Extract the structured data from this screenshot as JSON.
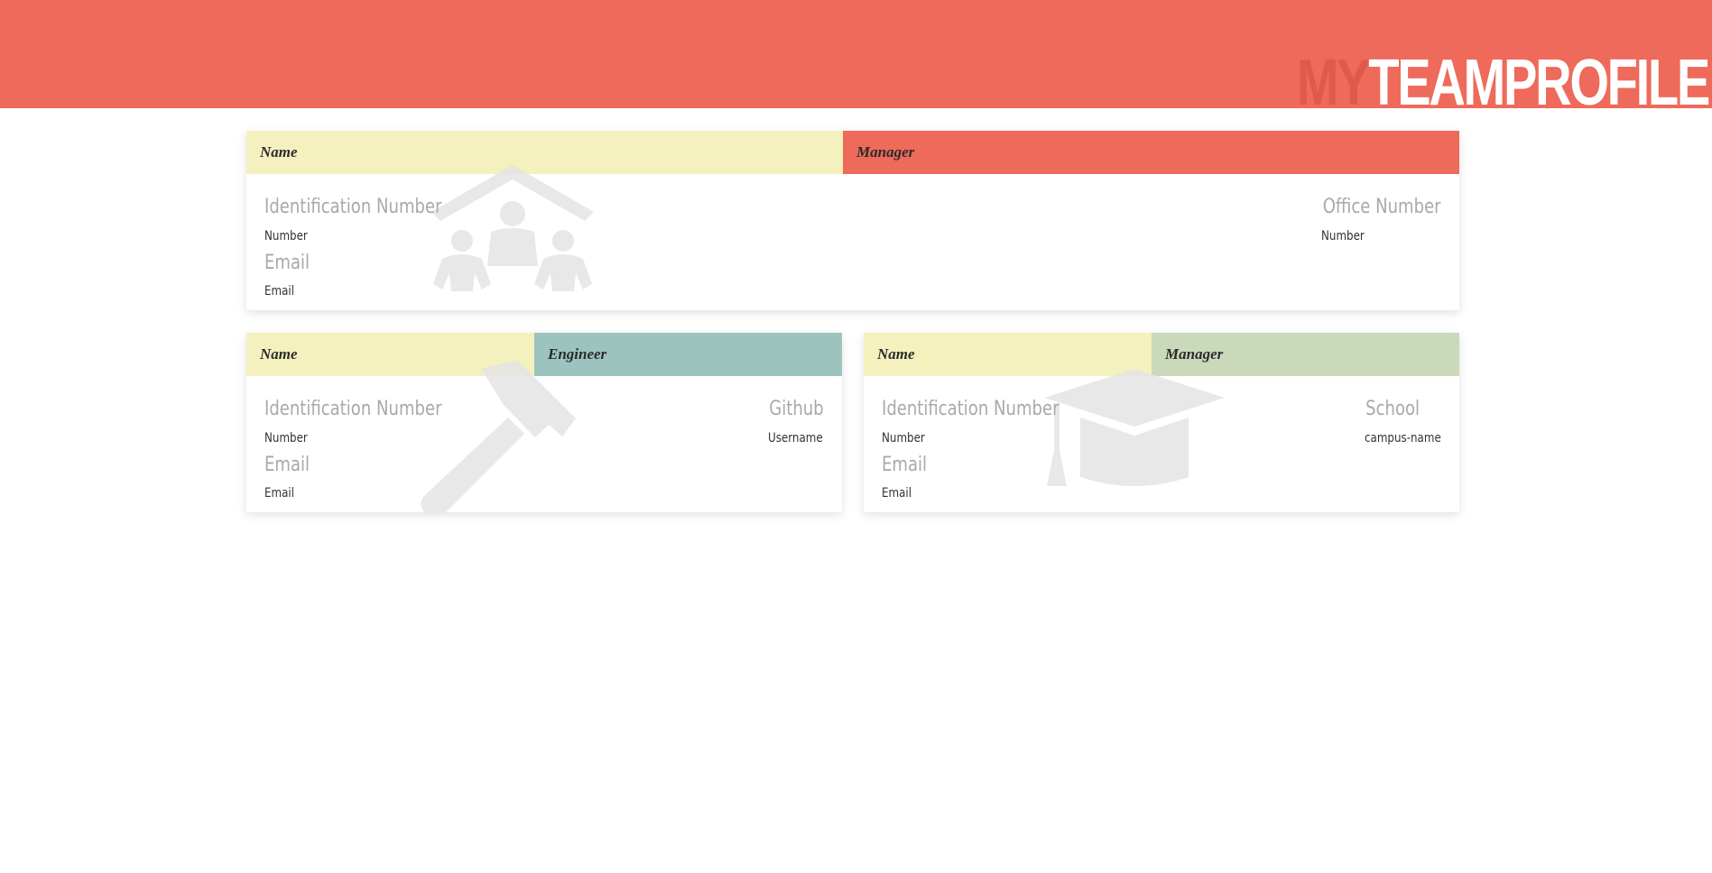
{
  "header": {
    "brand_prefix": "MY",
    "brand_main": "TEAMPROFILE",
    "background": "#ee6a5a"
  },
  "cards": [
    {
      "name": "Name",
      "role": "Manager",
      "role_color": "#ee6a5a",
      "icon": "family-icon",
      "id_label": "Identification Number",
      "id_value": "Number",
      "email_label": "Email",
      "email_value": "Email",
      "extra_label": "Office Number",
      "extra_value": "Number"
    },
    {
      "name": "Name",
      "role": "Engineer",
      "role_color": "#9cc3bd",
      "icon": "hammer-icon",
      "id_label": "Identification Number",
      "id_value": "Number",
      "email_label": "Email",
      "email_value": "Email",
      "extra_label": "Github",
      "extra_value": "Username"
    },
    {
      "name": "Name",
      "role": "Manager",
      "role_color": "#c9d9b9",
      "icon": "graduation-cap-icon",
      "id_label": "Identification Number",
      "id_value": "Number",
      "email_label": "Email",
      "email_value": "Email",
      "extra_label": "School",
      "extra_value": "campus-name"
    }
  ]
}
